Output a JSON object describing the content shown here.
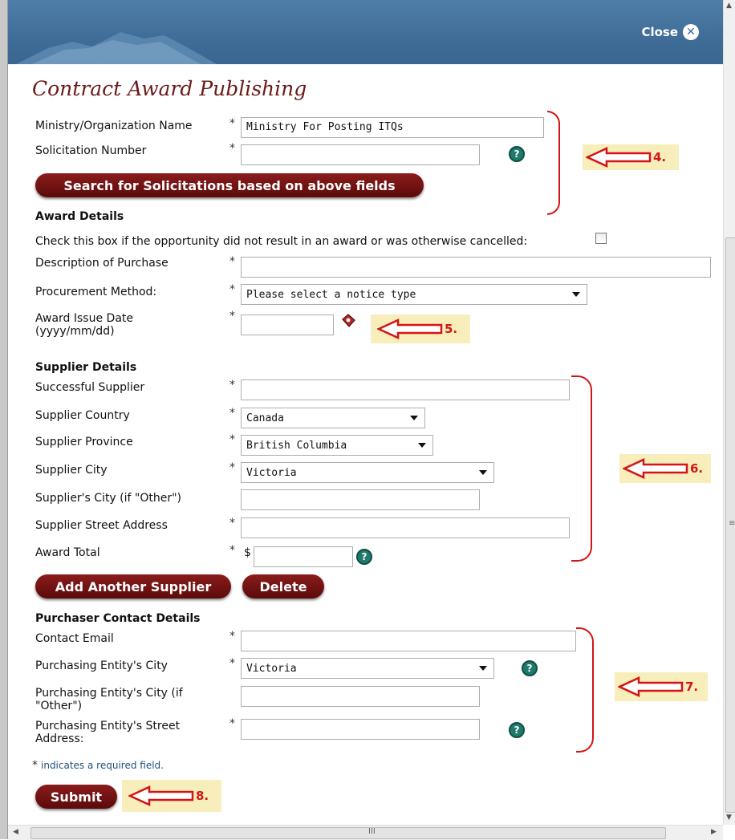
{
  "header": {
    "close_label": "Close"
  },
  "title": "Contract Award Publishing",
  "required_marker": "*",
  "fields": {
    "ministry": {
      "label": "Ministry/Organization Name",
      "value": "Ministry For Posting ITQs"
    },
    "solicitation": {
      "label": "Solicitation Number",
      "value": ""
    },
    "search_button": "Search for Solicitations based on above fields"
  },
  "award": {
    "heading": "Award Details",
    "cancel_text": "Check this box if the opportunity did not result in an award or was otherwise cancelled:",
    "description_label": "Description of Purchase",
    "procurement_label": "Procurement Method:",
    "procurement_value": "Please select a notice type",
    "issue_date_label_1": "Award Issue Date",
    "issue_date_label_2": "(yyyy/mm/dd)"
  },
  "supplier": {
    "heading": "Supplier Details",
    "successful_label": "Successful Supplier",
    "country_label": "Supplier Country",
    "country_value": "Canada",
    "province_label": "Supplier Province",
    "province_value": "British Columbia",
    "city_label": "Supplier City",
    "city_value": "Victoria",
    "city_other_label": "Supplier's City (if \"Other\")",
    "street_label": "Supplier Street Address",
    "total_label": "Award Total",
    "currency": "$",
    "add_button": "Add Another Supplier",
    "delete_button": "Delete"
  },
  "purchaser": {
    "heading": "Purchaser Contact Details",
    "email_label": "Contact Email",
    "city_label": "Purchasing Entity's City",
    "city_value": "Victoria",
    "city_other_label_1": "Purchasing Entity's City (if",
    "city_other_label_2": "\"Other\")",
    "street_label_1": "Purchasing Entity's Street",
    "street_label_2": "Address:"
  },
  "note": "indicates a required field.",
  "submit_button": "Submit",
  "callouts": {
    "c4": "4.",
    "c5": "5.",
    "c6": "6.",
    "c7": "7.",
    "c8": "8."
  },
  "help_glyph": "?",
  "scroll_grip": "III",
  "colors": {
    "header": "#3f6d98",
    "button": "#6b1010",
    "annotation": "#d41414",
    "callout_bg": "#f7eebb"
  }
}
